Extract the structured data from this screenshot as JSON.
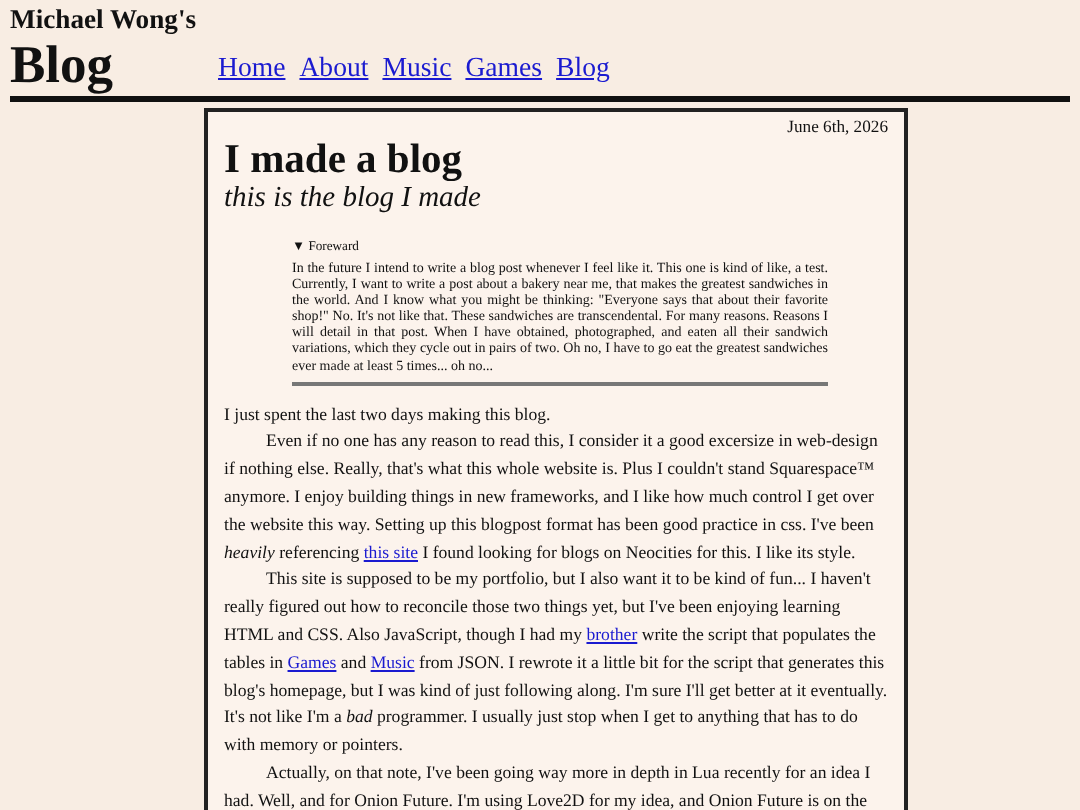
{
  "site": {
    "owner": "Michael Wong's",
    "title": "Blog"
  },
  "nav": [
    {
      "label": "Home"
    },
    {
      "label": "About"
    },
    {
      "label": "Music"
    },
    {
      "label": "Games"
    },
    {
      "label": "Blog"
    }
  ],
  "post": {
    "date": "June 6th, 2026",
    "title": "I made a blog",
    "subtitle": "this is the blog I made",
    "foreword": {
      "expanded": true,
      "marker": "▼",
      "label": "Foreward",
      "text": "In the future I intend to write a blog post whenever I feel like it. This one is kind of like, a test. Currently, I want to write a post about a bakery near me, that makes the greatest sandwiches in the world. And I know what you might be thinking: \"Everyone says that about their favorite shop!\" No. It's not like that. These sandwiches are transcendental. For many reasons. Reasons I will detail in that post. When I have obtained, photographed, and eaten all their sandwich variations, which they cycle out in pairs of two. Oh no, I have to go eat the greatest sandwiches ever made at least 5 times... oh no..."
    },
    "paragraphs": [
      {
        "indent": false,
        "parts": [
          {
            "kind": "text",
            "text": "I just spent the last two days making this blog."
          }
        ]
      },
      {
        "indent": true,
        "parts": [
          {
            "kind": "text",
            "text": "Even if no one has any reason to read this, I consider it a good excersize in web-design if nothing else. Really, that's what this whole website is. Plus I couldn't stand Squarespace™ anymore. I enjoy building things in new frameworks, and I like how much control I get over the website this way. Setting up this blogpost format has been good practice in css. I've been *heavily* referencing "
          },
          {
            "kind": "link",
            "text": "this site"
          },
          {
            "kind": "text",
            "text": " I found looking for blogs on Neocities for this. I like its style."
          }
        ]
      },
      {
        "indent": true,
        "parts": [
          {
            "kind": "text",
            "text": "This site is supposed to be my portfolio, but I also want it to be kind of fun... I haven't really figured out how to reconcile those two things yet, but I've been enjoying learning HTML and CSS. Also JavaScript, though I had my "
          },
          {
            "kind": "link",
            "text": "brother"
          },
          {
            "kind": "text",
            "text": " write the script that populates the tables in "
          },
          {
            "kind": "link",
            "text": "Games"
          },
          {
            "kind": "text",
            "text": " and "
          },
          {
            "kind": "link",
            "text": "Music"
          },
          {
            "kind": "text",
            "text": " from JSON. I rewrote it a little bit for the script that generates this blog's homepage, but I was kind of just following along. I'm sure I'll get better at it eventually. It's not like I'm a *bad* programmer. I usually just stop when I get to anything that has to do with memory or pointers."
          }
        ]
      },
      {
        "indent": true,
        "parts": [
          {
            "kind": "text",
            "text": "Actually, on that note, I've been going way more in depth in Lua recently for an idea I had. Well, and for Onion Future. I'm using Love2D for my idea, and Onion Future is on the"
          }
        ]
      }
    ]
  }
}
